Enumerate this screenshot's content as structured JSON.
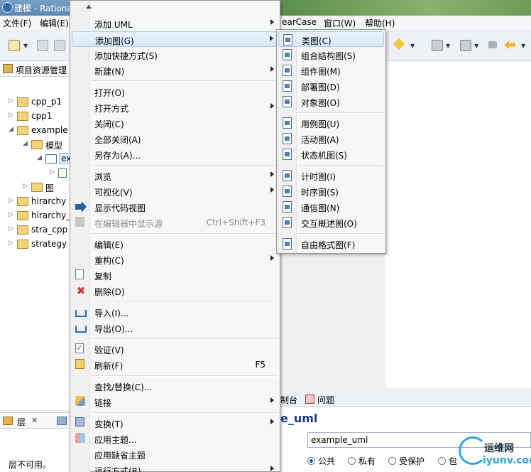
{
  "window": {
    "title": "建模 - Rationa"
  },
  "menubar": {
    "items": [
      "文件(F)",
      "编辑(E)"
    ],
    "right_items": [
      "earCase",
      "窗口(W)",
      "帮助(H)"
    ]
  },
  "explorer": {
    "tab_label": "项目资源管理",
    "tree": [
      {
        "label": "cpp_p1",
        "twisty": "▷"
      },
      {
        "label": "cpp1",
        "twisty": "▷"
      },
      {
        "label": "example",
        "twisty": "◢"
      },
      {
        "label": "模型",
        "twisty": "◢"
      },
      {
        "label": "ex",
        "twisty": "◢"
      },
      {
        "label": "",
        "twisty": "▷"
      },
      {
        "label": "图",
        "twisty": "▷"
      },
      {
        "label": "hirarchy",
        "twisty": "▷"
      },
      {
        "label": "hirarchy_",
        "twisty": "▷"
      },
      {
        "label": "stra_cpp",
        "twisty": "▷"
      },
      {
        "label": "strategy",
        "twisty": "▷"
      }
    ]
  },
  "layers": {
    "tab_label": "层",
    "close": "✕",
    "unavailable": "层不可用。"
  },
  "context_menu": {
    "items": [
      {
        "label": "添加 UML",
        "submenu": true
      },
      {
        "label": "添加图(G)",
        "submenu": true,
        "hover": true
      },
      {
        "label": "添加快捷方式(S)"
      },
      {
        "label": "新建(N)",
        "submenu": true
      },
      {
        "label": "打开(O)"
      },
      {
        "label": "打开方式",
        "submenu": true
      },
      {
        "label": "关闭(C)"
      },
      {
        "label": "全部关闭(A)"
      },
      {
        "label": "另存为(A)..."
      },
      {
        "label": "浏览",
        "submenu": true
      },
      {
        "label": "可视化(V)",
        "submenu": true
      },
      {
        "label": "显示代码视图"
      },
      {
        "label": "在编辑器中显示源",
        "shortcut": "Ctrl+Shift+F3",
        "disabled": true
      },
      {
        "label": "编辑(E)"
      },
      {
        "label": "重构(C)",
        "submenu": true
      },
      {
        "label": "复制"
      },
      {
        "label": "删除(D)"
      },
      {
        "label": "导入(I)..."
      },
      {
        "label": "导出(O)..."
      },
      {
        "label": "验证(V)"
      },
      {
        "label": "刷新(F)",
        "shortcut": "F5"
      },
      {
        "label": "查找/替换(C)..."
      },
      {
        "label": "链接",
        "submenu": true
      },
      {
        "label": "变换(T)",
        "submenu": true
      },
      {
        "label": "应用主题..."
      },
      {
        "label": "应用缺省主题"
      },
      {
        "label": "运行方式(R)",
        "submenu": true
      }
    ]
  },
  "submenu": {
    "items": [
      {
        "label": "类图(C)",
        "hover": true
      },
      {
        "label": "组合结构图(S)"
      },
      {
        "label": "组件图(M)"
      },
      {
        "label": "部署图(D)"
      },
      {
        "label": "对象图(O)"
      },
      {
        "label": "用例图(U)"
      },
      {
        "label": "活动图(A)"
      },
      {
        "label": "状态机图(S)"
      },
      {
        "label": "计时图(I)"
      },
      {
        "label": "时序图(S)"
      },
      {
        "label": "通信图(N)"
      },
      {
        "label": "交互概述图(O)"
      },
      {
        "label": "自由格式图(F)"
      }
    ]
  },
  "bottom": {
    "console_tab": "制台",
    "problems_tab": "问题",
    "properties_heading": "e_uml",
    "name_value": "example_uml",
    "visibility": [
      "公共",
      "私有",
      "受保护",
      "包"
    ],
    "visibility_selected": "公共"
  },
  "watermark": {
    "cn": "运维网",
    "en": "iyunv.com"
  }
}
